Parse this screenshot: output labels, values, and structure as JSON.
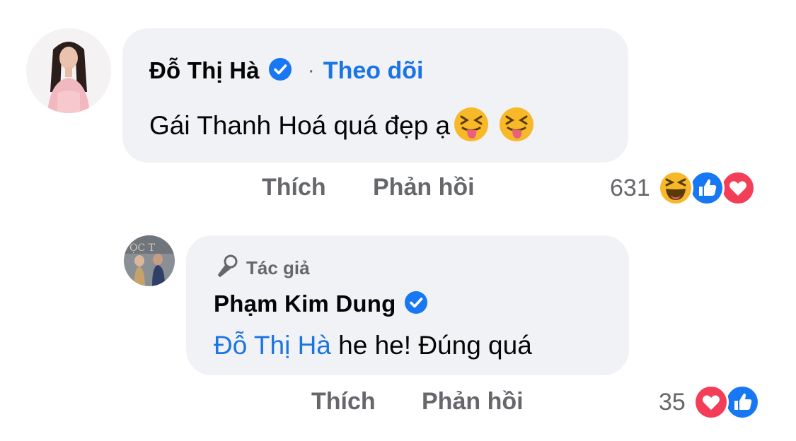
{
  "comment": {
    "author": "Đỗ Thị Hà",
    "separator": "·",
    "follow_label": "Theo dõi",
    "text": "Gái Thanh Hoá quá đẹp ạ",
    "emojis": [
      "squinting-tongue-emoji",
      "squinting-tongue-emoji"
    ],
    "actions": {
      "like": "Thích",
      "reply": "Phản hồi"
    },
    "reaction_count": "631",
    "reactions": [
      "haha",
      "like",
      "love"
    ]
  },
  "reply": {
    "author_tag": "Tác giả",
    "author": "Phạm Kim Dung",
    "mention": "Đỗ Thị Hà",
    "text": " he he! Đúng quá",
    "actions": {
      "like": "Thích",
      "reply": "Phản hồi"
    },
    "reaction_count": "35",
    "reactions": [
      "love",
      "like"
    ]
  },
  "colors": {
    "bubble": "#f0f2f5",
    "link_blue": "#1b74e4",
    "secondary_text": "#65676b",
    "like_blue": "#1877f2",
    "love_red": "#f33e58",
    "haha_yellow": "#f7b928"
  }
}
